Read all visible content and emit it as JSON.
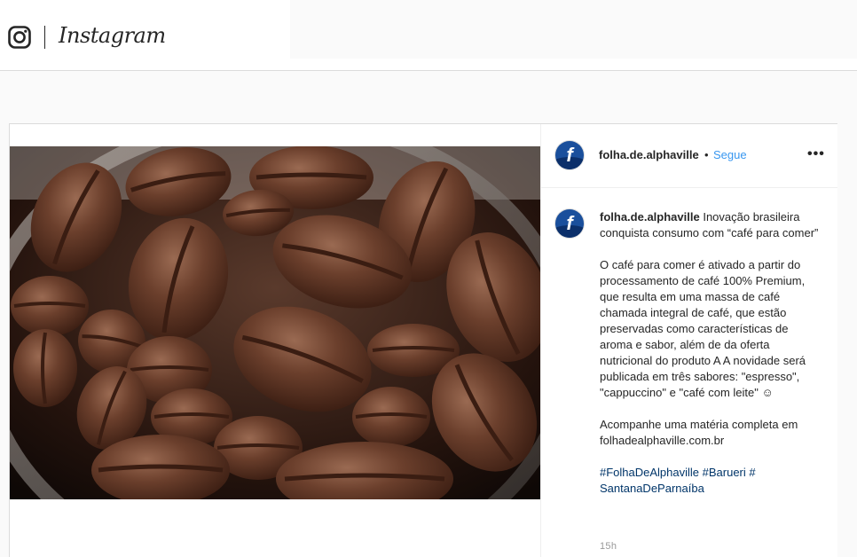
{
  "header": {
    "brand_name": "Instagram",
    "logo_icon": "instagram-glyph-icon"
  },
  "post": {
    "image_alt_icon": "chocolate-coffee-beans-photo",
    "author": {
      "username": "folha.de.alphaville",
      "separator": "•",
      "follow_status": "Segue",
      "avatar_initial": "f"
    },
    "more_options": "•••",
    "caption": {
      "username": "folha.de.alphaville",
      "headline": "Inovação brasileira conquista consumo com “café para comer”",
      "body": "O café para comer é ativado a partir do processamento de café 100% Premium, que resulta em uma massa de café chamada integral de café, que estão preservadas como características de aroma e sabor, além de da oferta nutricional do produto A A novidade será publicada em três sabores: \"espresso\", \"cappuccino\" e \"café com leite\" ☺",
      "cta": "Acompanhe uma matéria completa em folhadealphaville.com.br",
      "hashtags": "#FolhaDeAlphaville #Barueri # SantanaDeParnaíba"
    },
    "timestamp": "15h"
  },
  "colors": {
    "link_blue": "#3897f0",
    "hashtag_blue": "#003569",
    "border": "#dbdbdb",
    "avatar_blue": "#1a4f9c"
  }
}
